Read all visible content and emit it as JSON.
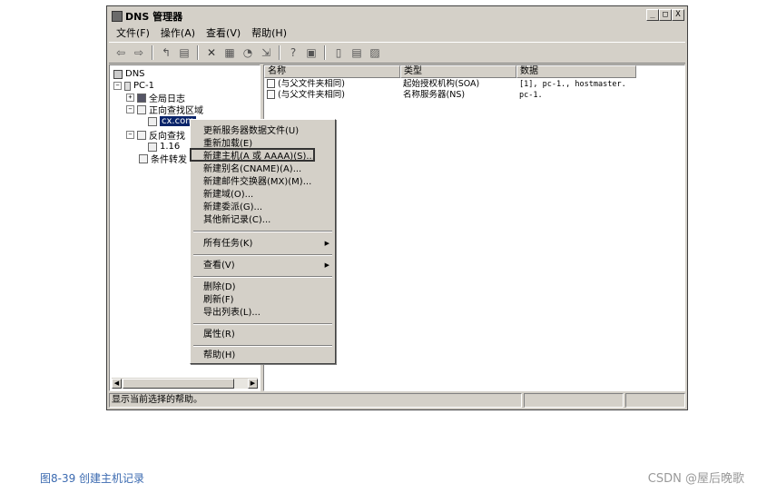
{
  "window": {
    "title": "DNS 管理器",
    "controls": {
      "minimize": "_",
      "maximize": "□",
      "close": "X"
    }
  },
  "menubar": {
    "items": [
      "文件(F)",
      "操作(A)",
      "查看(V)",
      "帮助(H)"
    ]
  },
  "toolbar": {
    "buttons": [
      "back-icon",
      "forward-icon",
      "up-icon",
      "show-hide-tree-icon",
      "delete-icon",
      "properties-icon",
      "refresh-icon",
      "export-icon",
      "help-icon",
      "console-icon",
      "server-icon",
      "record-icon",
      "filter-icon"
    ]
  },
  "tree": {
    "root": "DNS",
    "server": "PC-1",
    "global_logs": "全局日志",
    "forward_zone": "正向查找区域",
    "forward_child": "cx.com",
    "reverse_zone": "反向查找",
    "reverse_child": "1.16",
    "conditional": "条件转发"
  },
  "list": {
    "headers": {
      "name": "名称",
      "type": "类型",
      "data": "数据"
    },
    "rows": [
      {
        "name": "(与父文件夹相同)",
        "type": "起始授权机构(SOA)",
        "data": "[1], pc-1., hostmaster."
      },
      {
        "name": "(与父文件夹相同)",
        "type": "名称服务器(NS)",
        "data": "pc-1."
      }
    ]
  },
  "context_menu": {
    "update_server_file": "更新服务器数据文件(U)",
    "reload": "重新加载(E)",
    "new_host": "新建主机(A 或 AAAA)(S)...",
    "new_alias": "新建别名(CNAME)(A)...",
    "new_mx": "新建邮件交换器(MX)(M)...",
    "new_domain": "新建域(O)...",
    "new_delegation": "新建委派(G)...",
    "other_records": "其他新记录(C)...",
    "all_tasks": "所有任务(K)",
    "view": "查看(V)",
    "delete": "删除(D)",
    "refresh": "刷新(F)",
    "export_list": "导出列表(L)...",
    "properties": "属性(R)",
    "help": "帮助(H)"
  },
  "statusbar": {
    "text": "显示当前选择的帮助。"
  },
  "captions": {
    "figure": "图8-39  创建主机记录",
    "source": "CSDN @屋后晚歌"
  }
}
